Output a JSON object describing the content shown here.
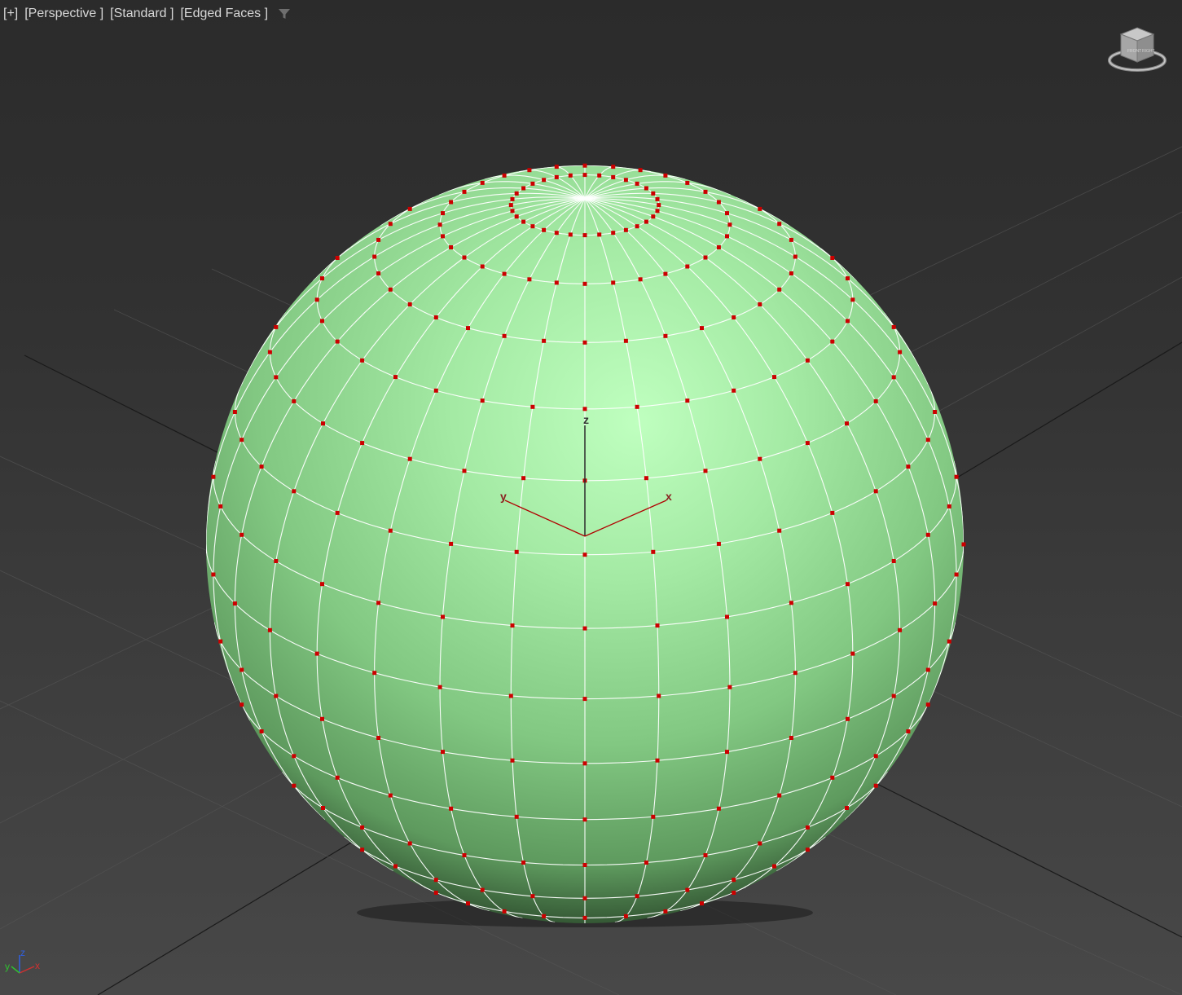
{
  "viewport": {
    "menu_plus": "[+]",
    "menu_view": "[Perspective ]",
    "menu_shading": "[Standard ]",
    "menu_display": "[Edged Faces ]",
    "filter_icon": "funnel-filter-icon",
    "viewcube_icon": "viewcube-icon",
    "viewcube_front_text": "FRONT",
    "viewcube_right_text": "RIGHT",
    "background_color": "#3a3a3a",
    "grid_color": "#1a1a1a"
  },
  "object": {
    "type": "sphere",
    "color": "#9be29b",
    "edge_color": "#ffffff",
    "vertex_color": "#cc0000",
    "segments": 32,
    "subobject_level": "vertex"
  },
  "gizmo": {
    "x_label": "x",
    "y_label": "y",
    "z_label": "z",
    "line_color": "#b00000"
  },
  "axis_tripod": {
    "x_label": "x",
    "y_label": "y",
    "z_label": "z",
    "x_color": "#d03030",
    "y_color": "#30c030",
    "z_color": "#3060e0"
  }
}
